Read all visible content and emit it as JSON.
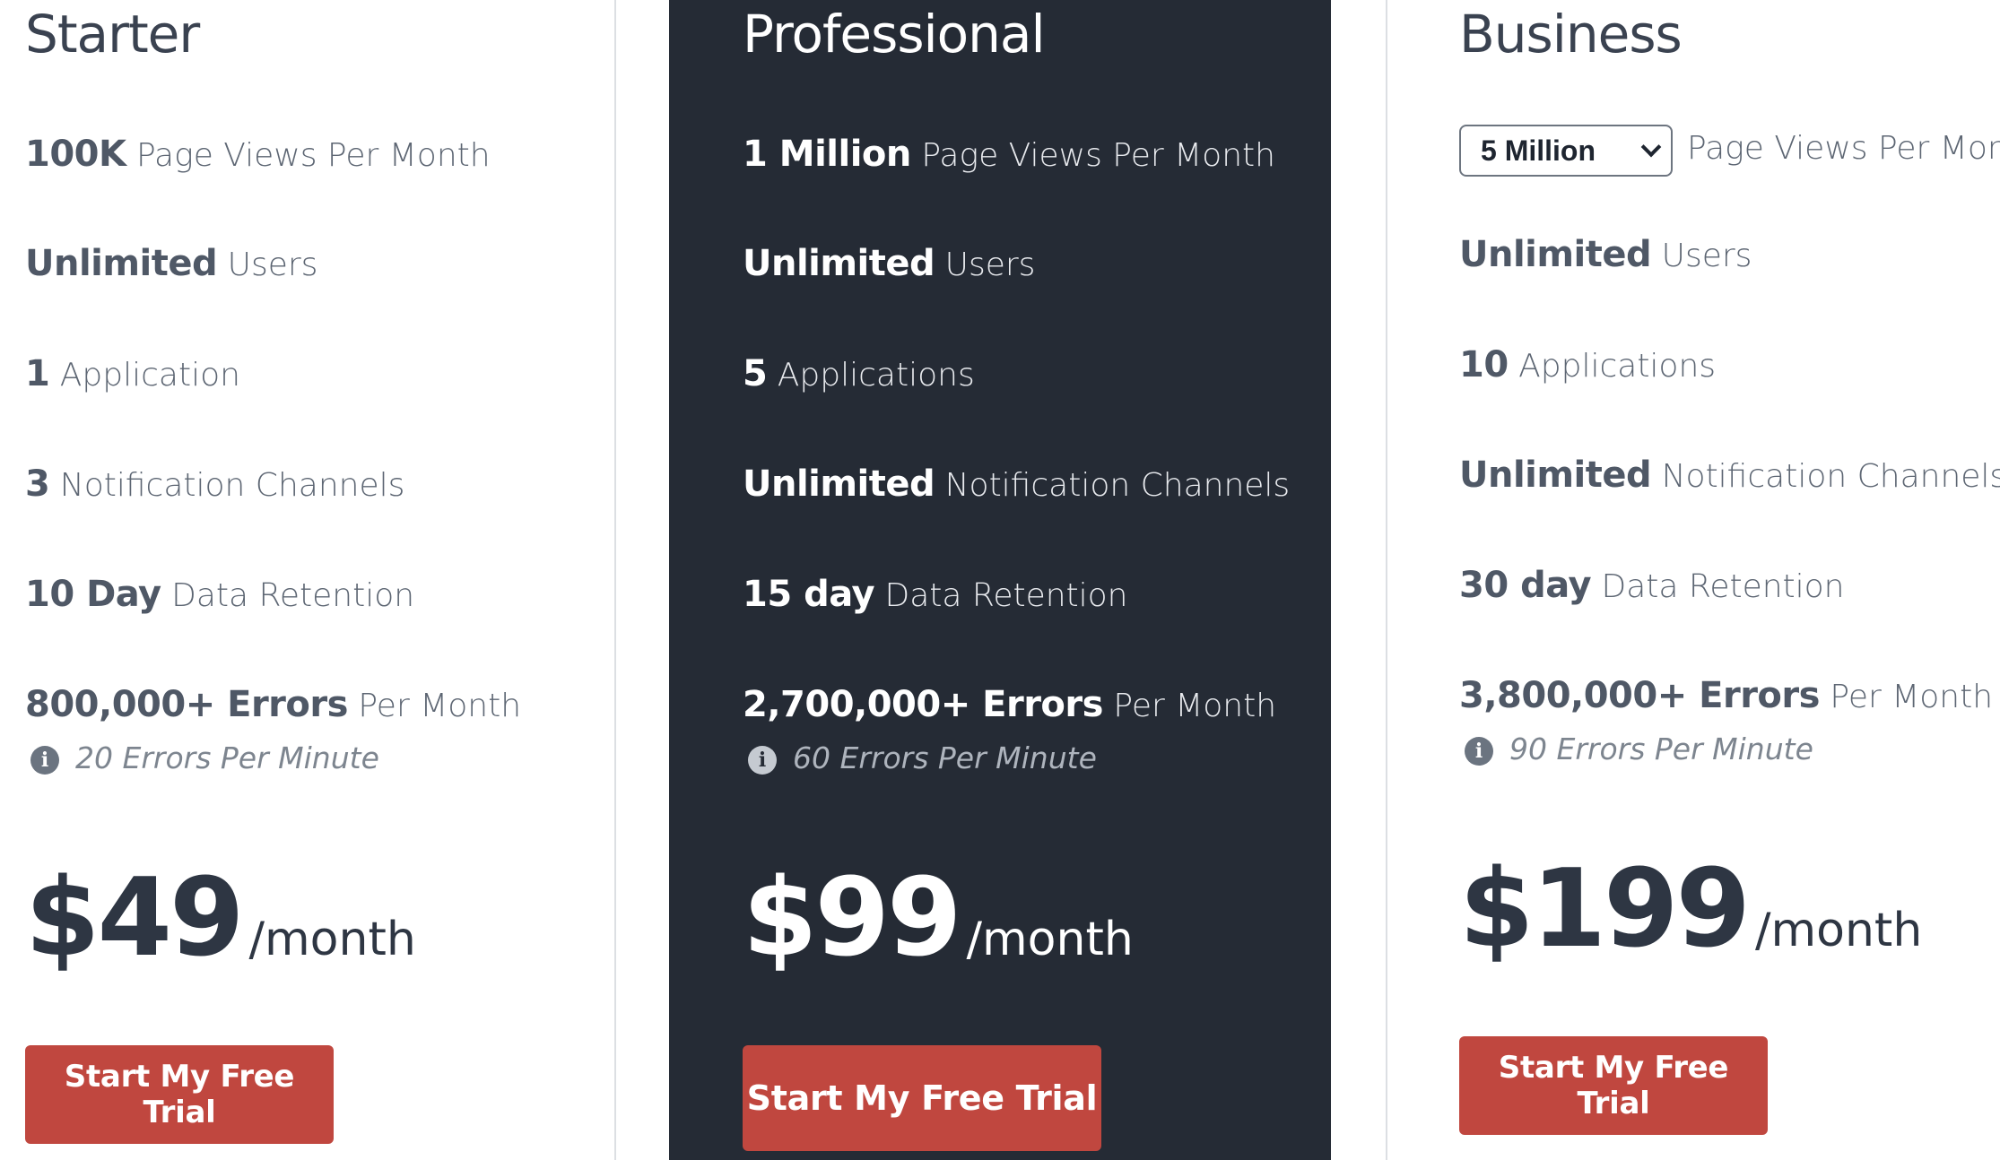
{
  "plans": {
    "starter": {
      "name": "Starter",
      "page_views": {
        "value": "100K",
        "label": "Page Views Per Month"
      },
      "users": {
        "value": "Unlimited",
        "label": "Users"
      },
      "applications": {
        "value": "1",
        "label": "Application"
      },
      "channels": {
        "value": "3",
        "label": "Notification Channels"
      },
      "retention": {
        "value": "10 Day",
        "label": "Data Retention"
      },
      "errors": {
        "value": "800,000+ Errors",
        "label": "Per Month"
      },
      "rate": "20 Errors Per Minute",
      "price": "$49",
      "per": "/month",
      "cta": "Start My Free Trial"
    },
    "professional": {
      "name": "Professional",
      "page_views": {
        "value": "1 Million",
        "label": "Page Views Per Month"
      },
      "users": {
        "value": "Unlimited",
        "label": "Users"
      },
      "applications": {
        "value": "5",
        "label": "Applications"
      },
      "channels": {
        "value": "Unlimited",
        "label": "Notification Channels"
      },
      "retention": {
        "value": "15 day",
        "label": "Data Retention"
      },
      "errors": {
        "value": "2,700,000+ Errors",
        "label": "Per Month"
      },
      "rate": "60 Errors Per Minute",
      "price": "$99",
      "per": "/month",
      "cta": "Start My Free Trial"
    },
    "business": {
      "name": "Business",
      "page_views": {
        "selected": "5 Million",
        "label": "Page Views Per Month"
      },
      "users": {
        "value": "Unlimited",
        "label": "Users"
      },
      "applications": {
        "value": "10",
        "label": "Applications"
      },
      "channels": {
        "value": "Unlimited",
        "label": "Notification Channels"
      },
      "retention": {
        "value": "30 day",
        "label": "Data Retention"
      },
      "errors": {
        "value": "3,800,000+ Errors",
        "label": "Per Month"
      },
      "rate": "90 Errors Per Minute",
      "price": "$199",
      "per": "/month",
      "cta": "Start My Free Trial"
    }
  },
  "icons": {
    "info": "info-circle-icon"
  },
  "colors": {
    "cta_background": "#c0473f",
    "featured_background": "#252b35",
    "text": "#4f5866"
  }
}
